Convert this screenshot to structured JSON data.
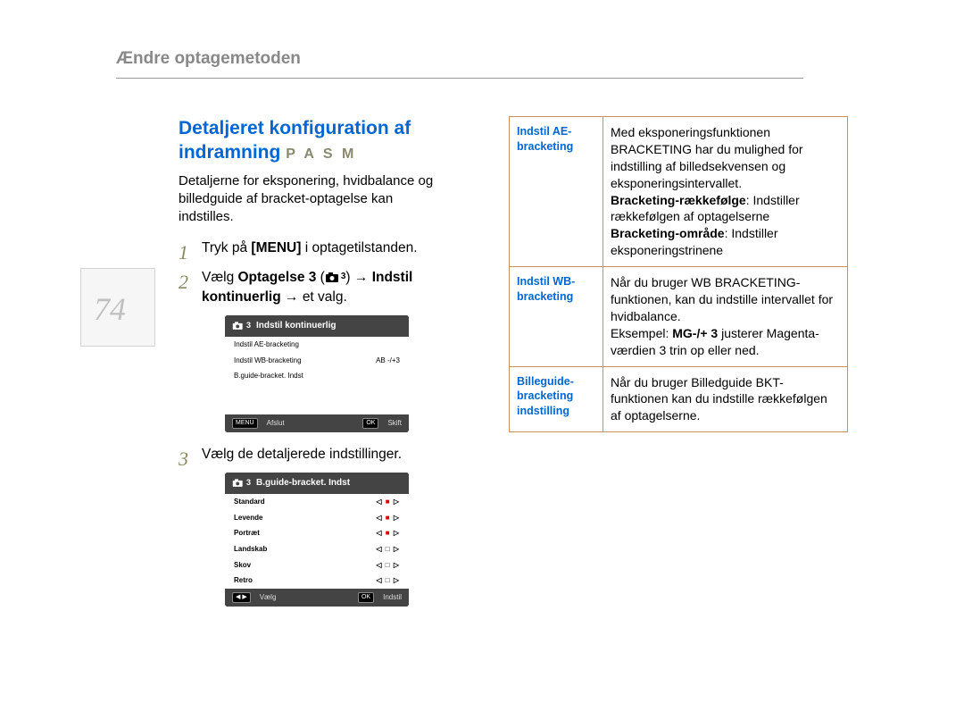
{
  "header": {
    "title": "Ændre optagemetoden"
  },
  "page_number": "74",
  "left": {
    "heading_line1": "Detaljeret konfiguration af",
    "heading_line2": "indramning",
    "modes": "P A S M",
    "intro": "Detaljerne for eksponering, hvidbalance og billedguide af bracket-optagelse kan indstilles.",
    "steps": {
      "s1": {
        "num": "1",
        "pre": "Tryk på ",
        "bold": "[MENU]",
        "post": " i optagetilstanden."
      },
      "s2": {
        "num": "2",
        "t_pre": "Vælg ",
        "t_b1": "Optagelse 3",
        "t_mid": " (",
        "t_icon_label": "camera-3",
        "t_mid2": ") → ",
        "t_b2": "Indstil kontinuerlig",
        "t_post": " → et valg."
      },
      "s3": {
        "num": "3",
        "text": "Vælg de detaljerede indstillinger."
      }
    },
    "panel1": {
      "head_three": "3",
      "head_title": "Indstil kontinuerlig",
      "rows": [
        {
          "l": "Indstil AE-bracketing",
          "r": ""
        },
        {
          "l": "Indstil WB-bracketing",
          "r": "AB -/+3"
        },
        {
          "l": "B.guide-bracket. Indst",
          "r": ""
        }
      ],
      "foot": {
        "k1": "MENU",
        "t1": "Afslut",
        "k2": "OK",
        "t2": "Skift"
      }
    },
    "panel2": {
      "head_three": "3",
      "head_title": "B.guide-bracket. Indst",
      "rows": [
        {
          "l": "Standard",
          "mark": "red"
        },
        {
          "l": "Levende",
          "mark": "red"
        },
        {
          "l": "Portræt",
          "mark": "red"
        },
        {
          "l": "Landskab",
          "mark": "plain"
        },
        {
          "l": "Skov",
          "mark": "plain"
        },
        {
          "l": "Retro",
          "mark": "plain"
        }
      ],
      "foot": {
        "k1": "◀ ▶",
        "t1": "Vælg",
        "k2": "OK",
        "t2": "Indstil"
      }
    }
  },
  "right": {
    "rows": [
      {
        "label": "Indstil AE-bracketing",
        "body_pre": "Med eksponeringsfunktionen BRACKETING har du mulighed for indstilling af billedsekvensen og eksponeringsintervallet.",
        "line2_b": "Bracketing-rækkefølge",
        "line2_t": ": Indstiller rækkefølgen af optagelserne",
        "line3_b": "Bracketing-område",
        "line3_t": ": Indstiller eksponeringstrinene"
      },
      {
        "label": "Indstil WB-bracketing",
        "body_pre": "Når du bruger WB BRACKETING-funktionen, kan du indstille intervallet for hvidbalance.",
        "ex_pre": "Eksempel: ",
        "ex_b": "MG-/+ 3",
        "ex_post": " justerer Magenta-værdien 3 trin op eller ned."
      },
      {
        "label": "Billeguide-bracketing indstilling",
        "body": "Når du bruger Billedguide BKT-funktionen kan du indstille rækkefølgen af optagelserne."
      }
    ]
  }
}
